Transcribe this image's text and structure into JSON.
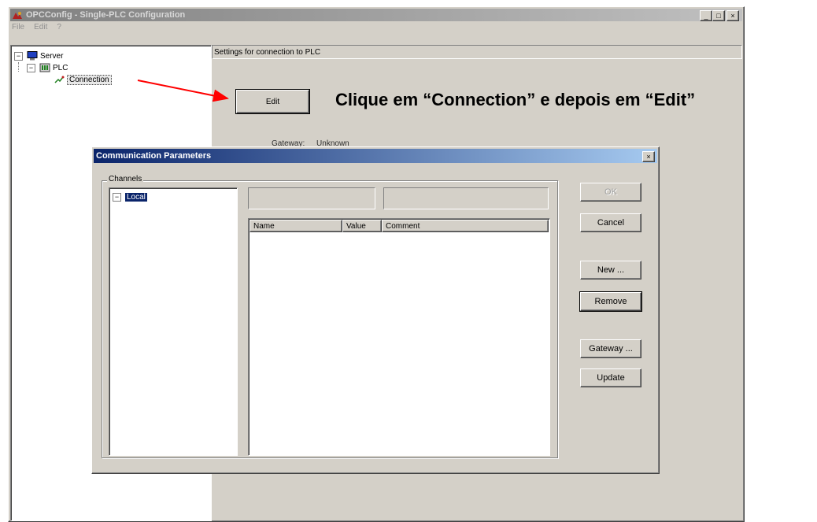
{
  "main_window": {
    "title": "OPCConfig - Single-PLC Configuration",
    "menu": [
      "File",
      "Edit",
      "?"
    ],
    "tree": {
      "server_label": "Server",
      "plc_label": "PLC",
      "connection_label": "Connection"
    },
    "settings_header": "Settings for connection to PLC",
    "edit_button": "Edit",
    "gateway_label": "Gateway:",
    "gateway_value": "Unknown"
  },
  "annotation": {
    "text": "Clique em “Connection” e depois em “Edit”",
    "arrow_color": "#ff0000"
  },
  "dialog": {
    "title": "Communication Parameters",
    "channels_label": "Channels",
    "tree_item": "Local",
    "columns": [
      "Name",
      "Value",
      "Comment"
    ],
    "buttons": {
      "ok": "OK",
      "cancel": "Cancel",
      "new": "New ...",
      "remove": "Remove",
      "gateway": "Gateway ...",
      "update": "Update"
    }
  },
  "colors": {
    "window_bg": "#d4d0c8",
    "title_active_start": "#0a246a",
    "title_active_end": "#a6caf0",
    "title_inactive_start": "#808080",
    "title_inactive_end": "#c0c0c0",
    "selection": "#0a246a"
  }
}
